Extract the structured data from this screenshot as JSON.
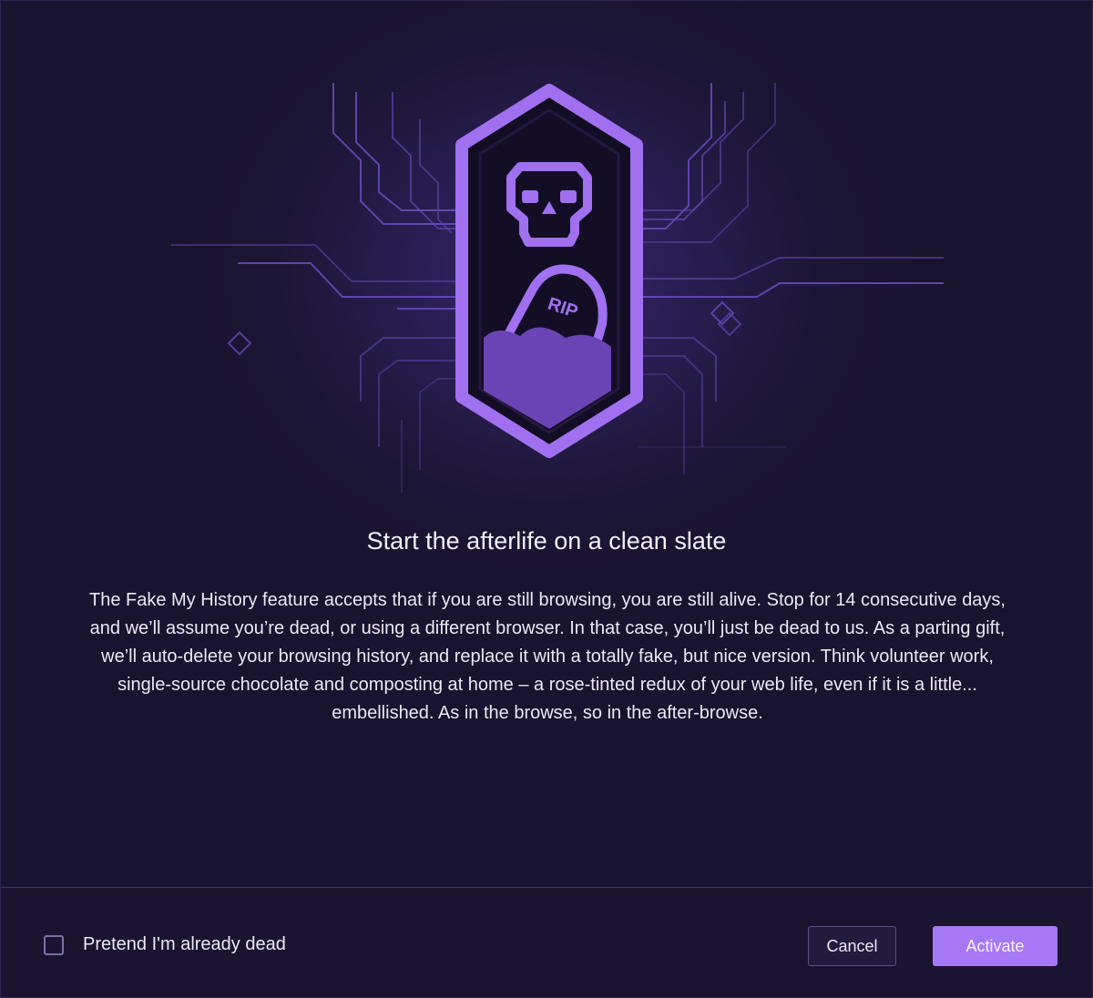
{
  "dialog": {
    "title": "Start the afterlife on a clean slate",
    "description": "The Fake My History feature accepts that if you are still browsing, you are still alive. Stop for 14 consecutive days, and we’ll assume you’re dead, or using a different browser. In that case, you’ll just be dead to us. As a parting gift, we’ll auto-delete your browsing history, and replace it with a totally fake, but nice version. Think volunteer work, single-source chocolate and composting at home – a rose-tinted redux of your web life, even if it is a little... embellished. As in the browse, so in the after-browse.",
    "badge_text": "RIP"
  },
  "footer": {
    "checkbox_label": "Pretend I'm already dead",
    "checkbox_checked": false,
    "cancel_label": "Cancel",
    "activate_label": "Activate"
  },
  "colors": {
    "accent": "#a778f5",
    "background": "#1a1430",
    "illustration": "#a070f0"
  },
  "icons": [
    "skull-icon",
    "tombstone-icon",
    "circuit-lines"
  ]
}
